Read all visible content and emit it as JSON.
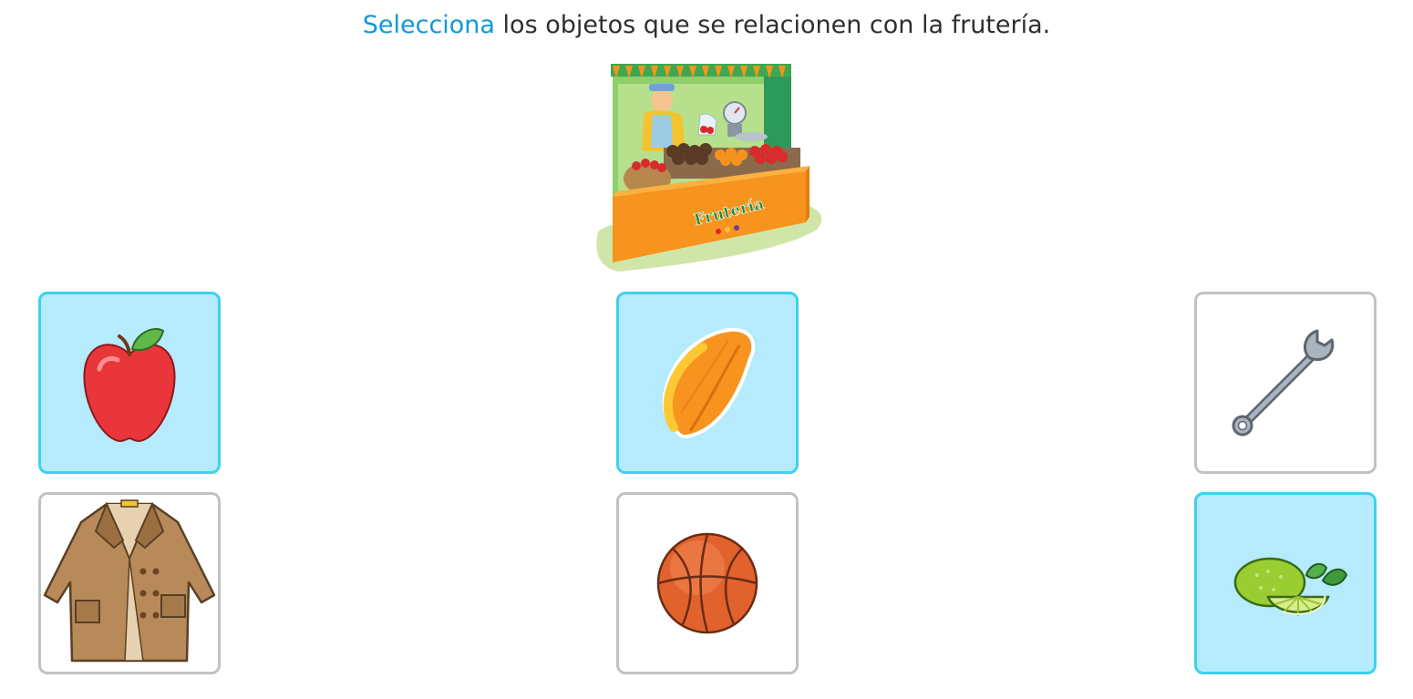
{
  "instruction": {
    "verb": "Selecciona",
    "rest": " los objetos que se relacionen con la frutería."
  },
  "scene": {
    "sign_text": "Frutería"
  },
  "colors": {
    "accent": "#1199d6",
    "selected_border": "#3fd0ee",
    "selected_background": "#b5ebfd",
    "unselected_border": "#c2c2c2"
  },
  "cards": [
    {
      "item": "apple",
      "icon": "apple-icon",
      "selected": true
    },
    {
      "item": "papaya",
      "icon": "papaya-icon",
      "selected": true
    },
    {
      "item": "wrench",
      "icon": "wrench-icon",
      "selected": false
    },
    {
      "item": "coat",
      "icon": "coat-icon",
      "selected": false
    },
    {
      "item": "basketball",
      "icon": "basketball-icon",
      "selected": false
    },
    {
      "item": "limes",
      "icon": "lime-icon",
      "selected": true
    }
  ]
}
